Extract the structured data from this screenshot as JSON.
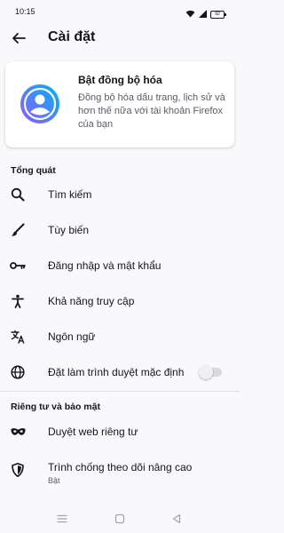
{
  "status_bar": {
    "time": "10:15",
    "battery": "92"
  },
  "header": {
    "title": "Cài đặt"
  },
  "sync_card": {
    "title": "Bật đồng bộ hóa",
    "description": "Đồng bộ hóa dấu trang, lịch sử và hơn thế nữa với tài khoản Firefox của bạn",
    "icon": "account-icon"
  },
  "sections": {
    "general": {
      "title": "Tổng quát"
    },
    "privacy": {
      "title": "Riêng tư và bảo mật"
    }
  },
  "general_items": [
    {
      "label": "Tìm kiếm",
      "icon": "search-icon"
    },
    {
      "label": "Tùy biến",
      "icon": "brush-icon"
    },
    {
      "label": "Đăng nhập và mật khẩu",
      "icon": "key-icon"
    },
    {
      "label": "Khả năng truy cập",
      "icon": "accessibility-icon"
    },
    {
      "label": "Ngôn ngữ",
      "icon": "translate-icon"
    },
    {
      "label": "Đặt làm trình duyệt mặc định",
      "icon": "globe-icon",
      "toggle": false
    }
  ],
  "privacy_items": [
    {
      "label": "Duyệt web riêng tư",
      "icon": "mask-icon"
    },
    {
      "label": "Trình chống theo dõi nâng cao",
      "sublabel": "Bật",
      "icon": "shield-icon"
    }
  ],
  "colors": {
    "accent": "#312a65",
    "avatar_gradient": [
      "#9059ff",
      "#00b3f4"
    ],
    "background": "#f9f9fb"
  }
}
